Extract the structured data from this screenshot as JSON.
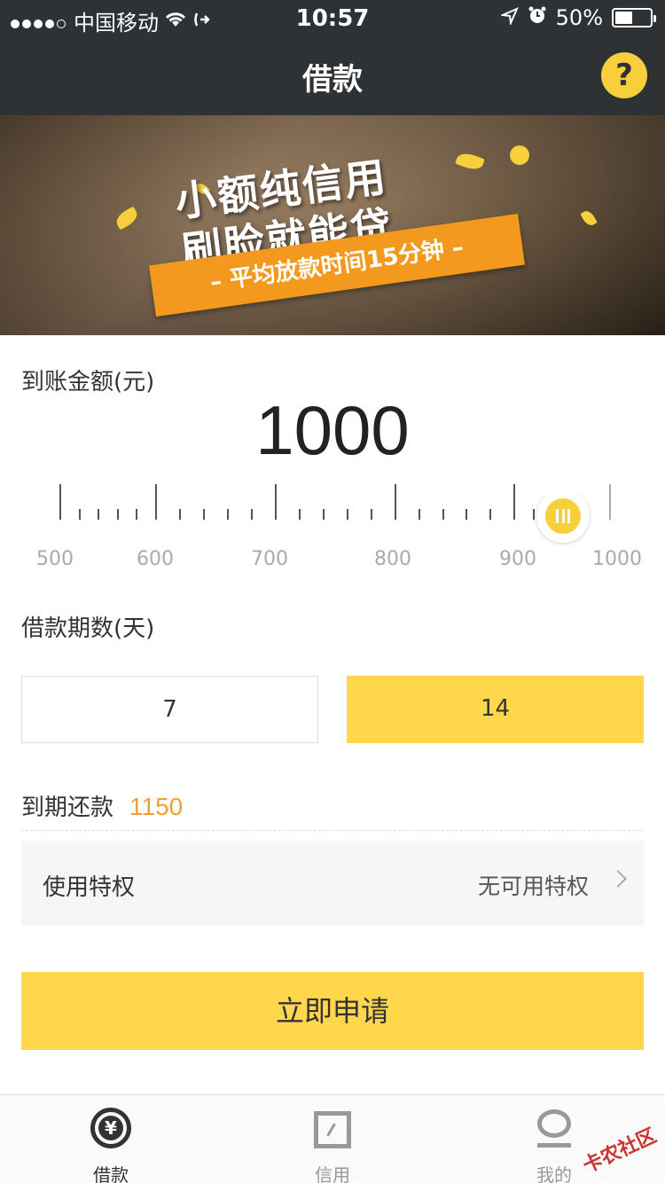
{
  "status_bar": {
    "carrier": "中国移动",
    "time": "10:57",
    "battery_percent": "50%",
    "battery_level": 0.5
  },
  "nav": {
    "title": "借款",
    "help_label": "?"
  },
  "banner": {
    "headline_line1": "小额纯信用",
    "headline_line2": "刷脸就能贷",
    "ribbon": "– 平均放款时间15分钟 –"
  },
  "amount_section": {
    "label": "到账金额(元)",
    "value": "1000",
    "slider_min": 500,
    "slider_max": 1000,
    "slider_value": 1000,
    "ruler_labels": [
      "500",
      "600",
      "700",
      "800",
      "900",
      "1000"
    ]
  },
  "period_section": {
    "label": "借款期数(天)",
    "options": [
      "7",
      "14"
    ],
    "selected": "14"
  },
  "repay": {
    "label": "到期还款",
    "value": "1150"
  },
  "privilege": {
    "label": "使用特权",
    "value": "无可用特权"
  },
  "apply_button": "立即申请",
  "tabs": [
    {
      "label": "借款",
      "icon": "yuan-coin-icon",
      "active": true
    },
    {
      "label": "信用",
      "icon": "credit-card-icon",
      "active": false
    },
    {
      "label": "我的",
      "icon": "user-icon",
      "active": false
    }
  ],
  "watermark": "卡农社区",
  "colors": {
    "nav_bg": "#2e3234",
    "accent_yellow": "#fed84a",
    "amount_orange": "#f0a030"
  }
}
